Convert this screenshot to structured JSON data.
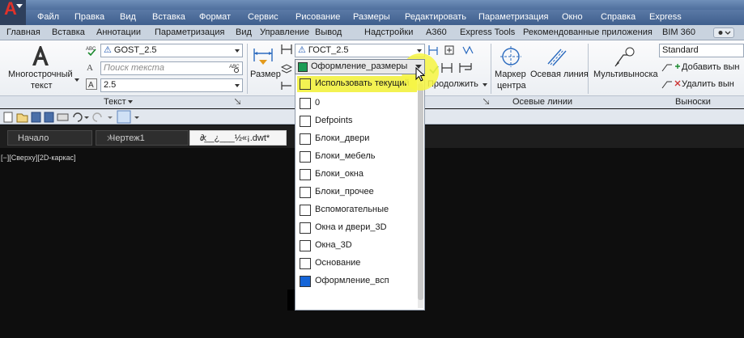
{
  "menubar": {
    "items": [
      "Файл",
      "Правка",
      "Вид",
      "Вставка",
      "Формат",
      "Сервис",
      "Рисование",
      "Размеры",
      "Редактировать",
      "Параметризация",
      "Окно",
      "Справка",
      "Express"
    ]
  },
  "ribbon_tabs": {
    "items": [
      "Главная",
      "Вставка",
      "Аннотации",
      "Параметризация",
      "Вид",
      "Управление",
      "Вывод",
      "Надстройки",
      "A360",
      "Express Tools",
      "Рекомендованные приложения",
      "BIM 360"
    ],
    "active": "Аннотации"
  },
  "ribbon": {
    "mtext": {
      "line1": "Многострочный",
      "line2": "текст"
    },
    "text_style": "GOST_2.5",
    "search_placeholder": "Поиск текста",
    "text_height": "2.5",
    "text_group_label": "Текст",
    "dim_style": "ГОСТ_2.5",
    "dim_label": "Размер",
    "continue_label": "Продолжить",
    "center_mark": {
      "line1": "Маркер",
      "line2": "центра"
    },
    "centerline_label": "Осевая линия",
    "centerlines_group_label": "Осевые линии",
    "multileader_label": "Мультивыноска",
    "leader_style": "Standard",
    "add_leader": "Добавить вын",
    "remove_leader": "Удалить вын",
    "leaders_group_label": "Выноски"
  },
  "doc_tabs": {
    "items": [
      "Начало",
      "Чертеж1",
      "∂__¿___½«¡.dwt*"
    ]
  },
  "viewport_label": "[−][Сверху][2D-каркас]",
  "layer_dropdown": {
    "current": "Оформление_размеры",
    "current_color": "#1c9c55",
    "items": [
      {
        "name": "Использовать текущий",
        "color": "#f3f252",
        "highlighted": true
      },
      {
        "name": "0",
        "color": "#ffffff"
      },
      {
        "name": "Defpoints",
        "color": "#ffffff"
      },
      {
        "name": "Блоки_двери",
        "color": "#ffffff"
      },
      {
        "name": "Блоки_мебель",
        "color": "#ffffff"
      },
      {
        "name": "Блоки_окна",
        "color": "#ffffff"
      },
      {
        "name": "Блоки_прочее",
        "color": "#ffffff"
      },
      {
        "name": "Вспомогательные",
        "color": "#ffffff"
      },
      {
        "name": "Окна и двери_3D",
        "color": "#ffffff"
      },
      {
        "name": "Окна_3D",
        "color": "#ffffff"
      },
      {
        "name": "Основание",
        "color": "#ffffff"
      },
      {
        "name": "Оформление_всп",
        "color": "#1565d8"
      }
    ]
  },
  "colors": {
    "highlight_yellow": "#f3f252",
    "menubar_blue": "#3f5f8d",
    "viewport_black": "#0e0e0e"
  }
}
